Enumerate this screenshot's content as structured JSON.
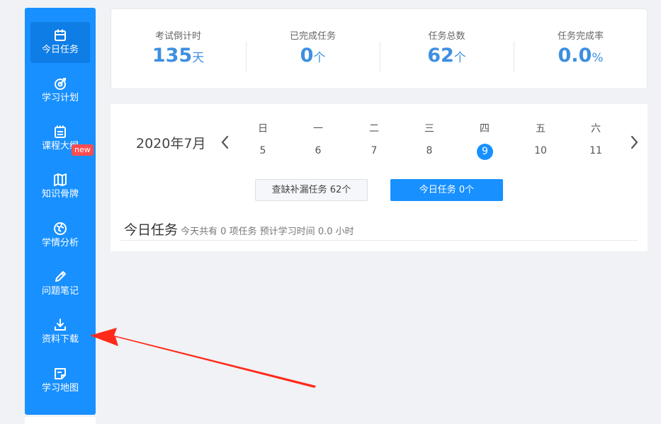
{
  "sidebar": {
    "items": [
      {
        "label": "今日任务",
        "icon": "calendar-icon"
      },
      {
        "label": "学习计划",
        "icon": "target-icon"
      },
      {
        "label": "课程大纲",
        "icon": "outline-icon"
      },
      {
        "label": "知识骨牌",
        "icon": "map-icon"
      },
      {
        "label": "学情分析",
        "icon": "globe-icon"
      },
      {
        "label": "问题笔记",
        "icon": "pencil-icon"
      },
      {
        "label": "资料下载",
        "icon": "download-icon"
      },
      {
        "label": "学习地图",
        "icon": "sticky-map-icon"
      }
    ],
    "badge": "new"
  },
  "stats": [
    {
      "label": "考试倒计时",
      "value": "135",
      "unit": "天"
    },
    {
      "label": "已完成任务",
      "value": "0",
      "unit": "个"
    },
    {
      "label": "任务总数",
      "value": "62",
      "unit": "个"
    },
    {
      "label": "任务完成率",
      "value": "0.0",
      "unit": "%"
    }
  ],
  "calendar": {
    "month": "2020年7月",
    "days": [
      {
        "weekday": "日",
        "date": "5"
      },
      {
        "weekday": "一",
        "date": "6"
      },
      {
        "weekday": "二",
        "date": "7"
      },
      {
        "weekday": "三",
        "date": "8"
      },
      {
        "weekday": "四",
        "date": "9"
      },
      {
        "weekday": "五",
        "date": "10"
      },
      {
        "weekday": "六",
        "date": "11"
      }
    ]
  },
  "buttons": {
    "missing": "查缺补漏任务 62个",
    "today": "今日任务 0个"
  },
  "section": {
    "title": "今日任务",
    "subtitle": "今天共有 0 项任务 预计学习时间 0.0 小时"
  },
  "colors": {
    "accent": "#1890ff",
    "stat_value": "#3d8fe0",
    "badge": "#ff4d4f",
    "annotation": "#ff2a1a"
  }
}
